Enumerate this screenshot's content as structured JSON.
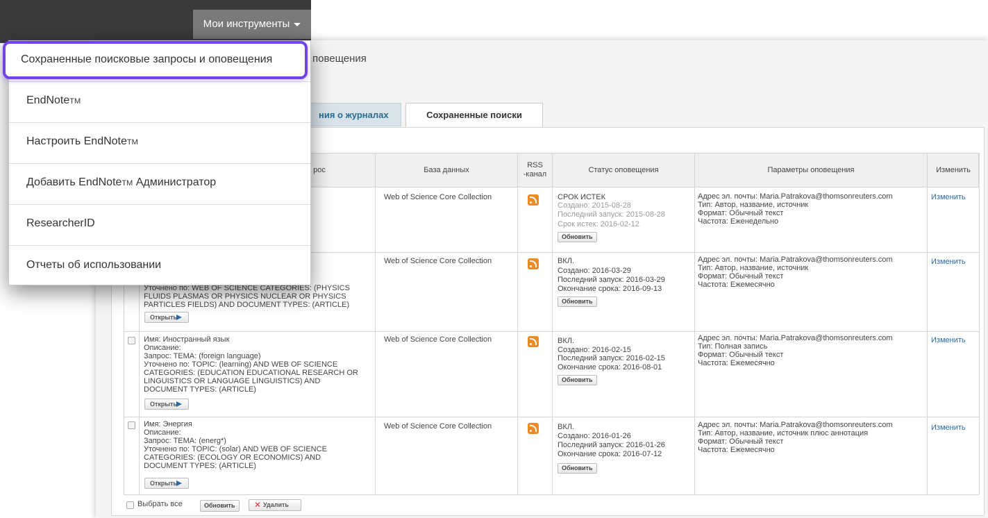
{
  "header": {
    "tools_label": "Мои инструменты"
  },
  "page": {
    "title": "повещения"
  },
  "tabs": [
    {
      "label": "ния о журналах"
    },
    {
      "label": "Сохраненные поиски"
    }
  ],
  "table": {
    "columns": [
      "рос",
      "База данных",
      "RSS",
      "-канал",
      "Статус оповещения",
      "Параметры оповещения",
      "Изменить"
    ],
    "rows": [
      {
        "query_lines": [],
        "database": "Web of Science Core Collection",
        "status": "СРОК ИСТЕК",
        "status_lines": [
          "Создано: 2015-08-28",
          "Последний запуск: 2015-08-28",
          "Срок истек: 2016-02-12"
        ],
        "update": "Обновить",
        "params": [
          "Адрес эл. почты: Maria.Patrakova@thomsonreuters.com",
          "Тип: Автор, название, источник",
          "Формат: Обычный текст",
          "Частота: Еженедельно"
        ],
        "edit": "Изменить"
      },
      {
        "query_lines": [
          "Уточнено по: WEB OF SCIENCE CATEGORIES: (PHYSICS",
          "FLUIDS PLASMAS OR PHYSICS NUCLEAR OR PHYSICS",
          "PARTICLES FIELDS) AND DOCUMENT TYPES: (ARTICLE)"
        ],
        "open": "Открыть",
        "database": "Web of Science Core Collection",
        "status": "ВКЛ.",
        "status_lines": [
          "Создано: 2016-03-29",
          "Последний запуск: 2016-03-29",
          "Окончание срока: 2016-09-13"
        ],
        "update": "Обновить",
        "params": [
          "Адрес эл. почты: Maria.Patrakova@thomsonreuters.com",
          "Тип: Автор, название, источник",
          "Формат: Обычный текст",
          "Частота: Ежемесячно"
        ],
        "edit": "Изменить"
      },
      {
        "query_lines": [
          "Имя: Иностранный язык",
          "Описание:",
          "Запрос: TEMA: (foreign language)",
          "Уточнено по: TOPIC: (learning) AND WEB OF SCIENCE",
          "CATEGORIES: (EDUCATION EDUCATIONAL RESEARCH OR",
          "LINGUISTICS OR LANGUAGE LINGUISTICS) AND",
          "DOCUMENT TYPES: (ARTICLE)"
        ],
        "open": "Открыть",
        "database": "Web of Science Core Collection",
        "status": "ВКЛ.",
        "status_lines": [
          "Создано: 2016-02-15",
          "Последний запуск: 2016-02-15",
          "Окончание срока: 2016-08-01"
        ],
        "update": "Обновить",
        "params": [
          "Адрес эл. почты: Maria.Patrakova@thomsonreuters.com",
          "Тип: Полная запись",
          "Формат: Обычный текст",
          "Частота: Ежемесячно"
        ],
        "edit": "Изменить"
      },
      {
        "query_lines": [
          "Имя: Энергия",
          "Описание:",
          "Запрос: TEMA: (energ*)",
          "Уточнено по: TOPIC: (solar) AND WEB OF SCIENCE",
          "CATEGORIES: (ECOLOGY OR ECONOMICS) AND",
          "DOCUMENT TYPES: (ARTICLE)"
        ],
        "open": "Открыть",
        "database": "Web of Science Core Collection",
        "status": "ВКЛ.",
        "status_lines": [
          "Создано: 2016-01-26",
          "Последний запуск: 2016-01-26",
          "Окончание срока: 2016-07-12"
        ],
        "update": "Обновить",
        "params": [
          "Адрес эл. почты: Maria.Patrakova@thomsonreuters.com",
          "Тип: Автор, название, источник плюс аннотация",
          "Формат: Обычный текст",
          "Частота: Ежемесячно"
        ],
        "edit": "Изменить"
      }
    ]
  },
  "footer": {
    "select_all": "Выбрать все",
    "update": "Обновить",
    "delete": "Удалить"
  },
  "menu": {
    "items": [
      {
        "label": "Сохраненные поисковые запросы и оповещения"
      },
      {
        "label": "EndNote",
        "tm": "TM"
      },
      {
        "label": "Настроить EndNote",
        "tm": "TM"
      },
      {
        "label": "Добавить EndNote",
        "tm": "TM",
        "suffix": " Администратор"
      },
      {
        "label": "ResearcherID"
      },
      {
        "label": "Отчеты об использовании"
      }
    ]
  },
  "colors": {
    "highlight": "#7243e8",
    "link": "#2a6aa5",
    "rss": "#f08a24"
  }
}
